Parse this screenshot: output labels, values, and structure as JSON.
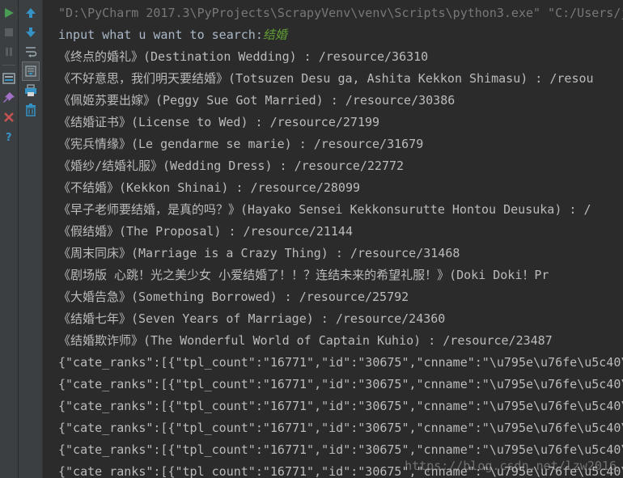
{
  "console": {
    "command_line": "\"D:\\PyCharm 2017.3\\PyProjects\\ScrapyVenv\\venv\\Scripts\\python3.exe\" \"C:/Users/j",
    "prompt": "input what u want to search:",
    "user_input": "结婚",
    "results": [
      "《终点的婚礼》(Destination Wedding) : /resource/36310",
      "《不好意思，我们明天要结婚》(Totsuzen Desu ga, Ashita Kekkon Shimasu) : /resou",
      "《佩姬苏要出嫁》(Peggy Sue Got Married) : /resource/30386",
      "《结婚证书》(License to Wed) : /resource/27199",
      "《宪兵情缘》(Le gendarme se marie) : /resource/31679",
      "《婚纱/结婚礼服》(Wedding Dress) : /resource/22772",
      "《不结婚》(Kekkon Shinai) : /resource/28099",
      "《早子老师要结婚，是真的吗？》(Hayako Sensei Kekkonsurutte Hontou Deusuka) : /",
      "《假结婚》(The Proposal) : /resource/21144",
      "《周末同床》(Marriage is a Crazy Thing) : /resource/31468",
      "《剧场版 心跳！光之美少女 小爱结婚了！！？连结未来的希望礼服！》(Doki Doki！Pr",
      "《大婚告急》(Something Borrowed) : /resource/25792",
      "《结婚七年》(Seven Years of Marriage) : /resource/24360",
      "《结婚欺诈师》(The Wonderful World of Captain Kuhio) : /resource/23487"
    ],
    "json_lines": [
      "{\"cate_ranks\":[{\"tpl_count\":\"16771\",\"id\":\"30675\",\"cnname\":\"\\u795e\\u76fe\\u5c40\\",
      "{\"cate_ranks\":[{\"tpl_count\":\"16771\",\"id\":\"30675\",\"cnname\":\"\\u795e\\u76fe\\u5c40\\",
      "{\"cate_ranks\":[{\"tpl_count\":\"16771\",\"id\":\"30675\",\"cnname\":\"\\u795e\\u76fe\\u5c40\\",
      "{\"cate_ranks\":[{\"tpl_count\":\"16771\",\"id\":\"30675\",\"cnname\":\"\\u795e\\u76fe\\u5c40\\",
      "{\"cate_ranks\":[{\"tpl_count\":\"16771\",\"id\":\"30675\",\"cnname\":\"\\u795e\\u76fe\\u5c40\\",
      "{\"cate_ranks\":[{\"tpl_count\":\"16771\",\"id\":\"30675\",\"cnname\":\"\\u795e\\u76fe\\u5c40\\"
    ],
    "watermark": "https://blog.csdn.net/lzw2016"
  },
  "toolbar_left": {
    "icons": [
      "run-icon",
      "stop-icon",
      "pause-icon",
      "dump-threads-icon",
      "pin-tab-icon",
      "close-icon",
      "help-icon"
    ]
  },
  "toolbar_right": {
    "icons": [
      "scroll-up-icon",
      "scroll-down-icon",
      "soft-wrap-icon",
      "scroll-to-end-icon",
      "print-icon",
      "clear-all-icon"
    ]
  },
  "colors": {
    "background": "#2b2b2b",
    "toolbar": "#3c3f41",
    "text": "#bbbbbb",
    "command": "#787878",
    "input_green": "#62a035",
    "run_green": "#499c54",
    "stop_red": "#c75450",
    "arrow_blue": "#3592c4"
  }
}
